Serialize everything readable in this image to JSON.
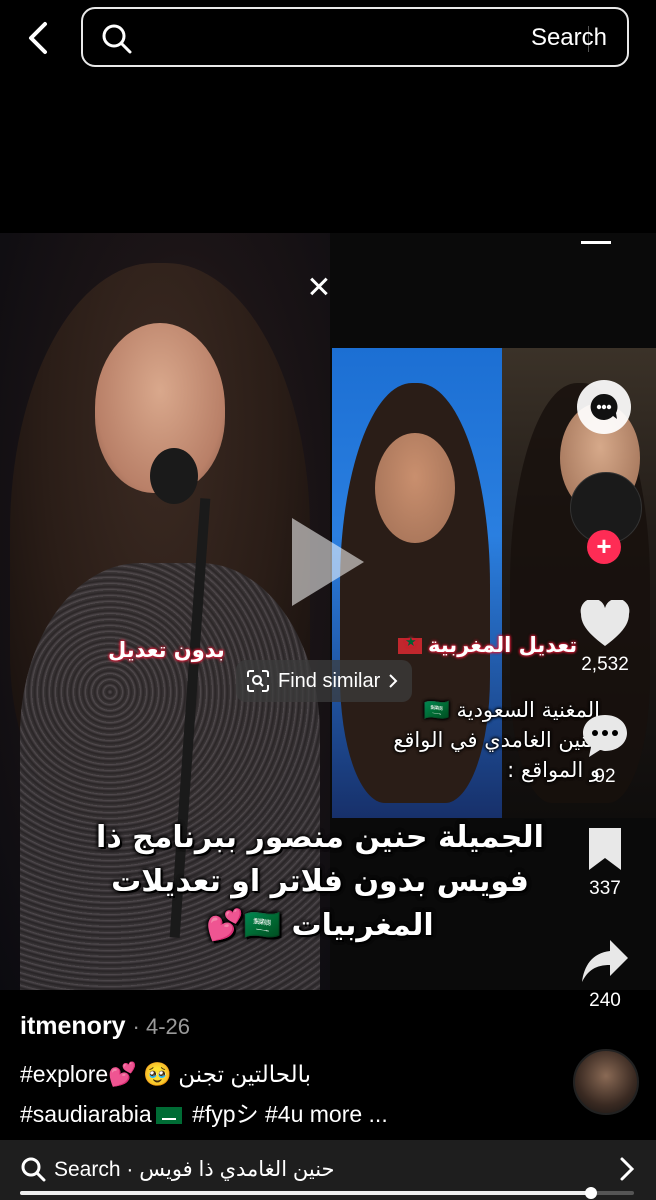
{
  "search": {
    "placeholder": "",
    "button_label": "Search"
  },
  "video": {
    "caption_left": "بدون تعديل",
    "caption_right": "تعديل المغربية",
    "caption_black_lines": [
      "المغنية السعودية 🇸🇦",
      "حنين الغامدي في الواقع",
      "و المواقع :"
    ],
    "big_caption_lines": [
      "الجميلة حنين منصور ببرنامج ذا",
      "فويس بدون فلاتر او تعديلات",
      "المغربيات 🇸🇦💕"
    ],
    "find_similar_label": "Find similar",
    "progress": 0.93
  },
  "rail": {
    "likes": "2,532",
    "comments": "92",
    "saves": "337",
    "shares": "240"
  },
  "post": {
    "author": "itmenory",
    "date": "· 4-26",
    "description_line1": "#explore💕 🥹 بالحالتين تجنن",
    "hashtag_saudi": "#saudiarabia",
    "hashtag_fyp": "#fypシ",
    "hashtag_4u": "#4u",
    "more_label": "more ..."
  },
  "bottom_search": {
    "label": "Search · حنين الغامدي ذا فويس"
  },
  "colors": {
    "accent_pink": "#fe2c55",
    "background": "#000000"
  }
}
